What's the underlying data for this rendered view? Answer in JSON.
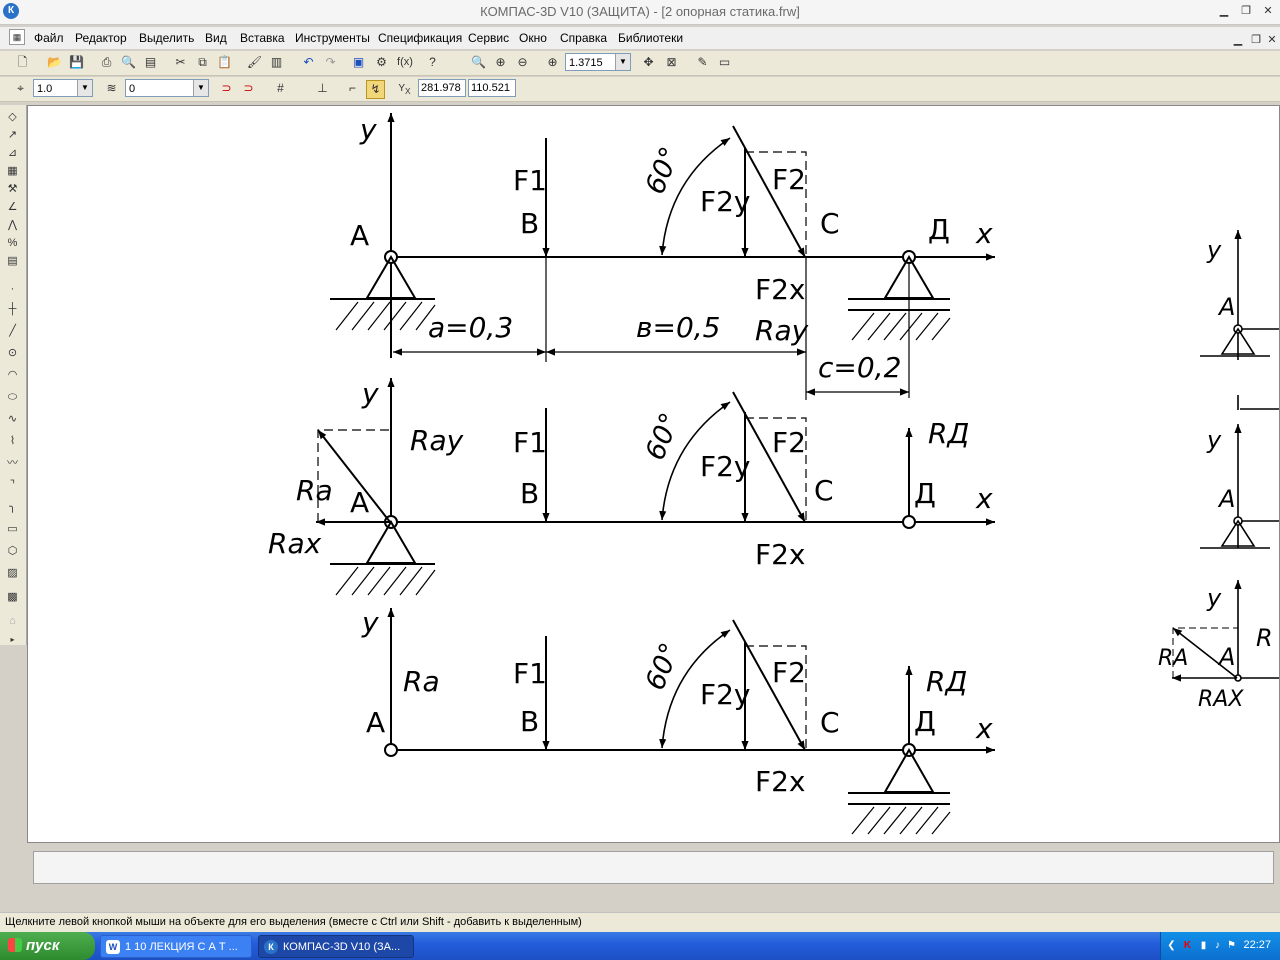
{
  "window": {
    "title": "КОМПАС-3D V10 (ЗАЩИТА) - [2 опорная статика.frw]",
    "app_icon": "К"
  },
  "menu": [
    "Файл",
    "Редактор",
    "Выделить",
    "Вид",
    "Вставка",
    "Инструменты",
    "Спецификация",
    "Сервис",
    "Окно",
    "Справка",
    "Библиотеки"
  ],
  "toolbar": {
    "zoom_value": "1.3715",
    "fx_label": "f(x)"
  },
  "props_bar": {
    "step_value": "1.0",
    "layer_value": "0",
    "coord_x": "281.978",
    "coord_y": "110.521"
  },
  "drawing": {
    "labels": {
      "y": "y",
      "x": "x",
      "A": "A",
      "B": "B",
      "C": "C",
      "D": "Д",
      "F1": "F1",
      "F2": "F2",
      "F2y": "F2y",
      "F2x": "F2x",
      "angle": "60°",
      "a": "a=0,3",
      "b": "в=0,5",
      "c": "c=0,2",
      "Ray": "Ray",
      "Ra": "Ra",
      "Rax": "Rax",
      "RD": "RД",
      "RA_small": "RA",
      "RAX_small": "RAX",
      "R_cut": "R"
    }
  },
  "status": {
    "hint": "Щелкните левой кнопкой мыши на объекте для его выделения (вместе с Ctrl или Shift - добавить к выделенным)"
  },
  "taskbar": {
    "start_label": "пуск",
    "tasks": [
      {
        "label": "1 10 ЛЕКЦИЯ С А Т ...",
        "icon": "W"
      },
      {
        "label": "КОМПАС-3D V10 (ЗА...",
        "icon": "К"
      }
    ],
    "clock": "22:27"
  },
  "colors": {
    "taskbar": "#245edb",
    "start": "#2e8a2e",
    "canvas": "#ffffff"
  }
}
